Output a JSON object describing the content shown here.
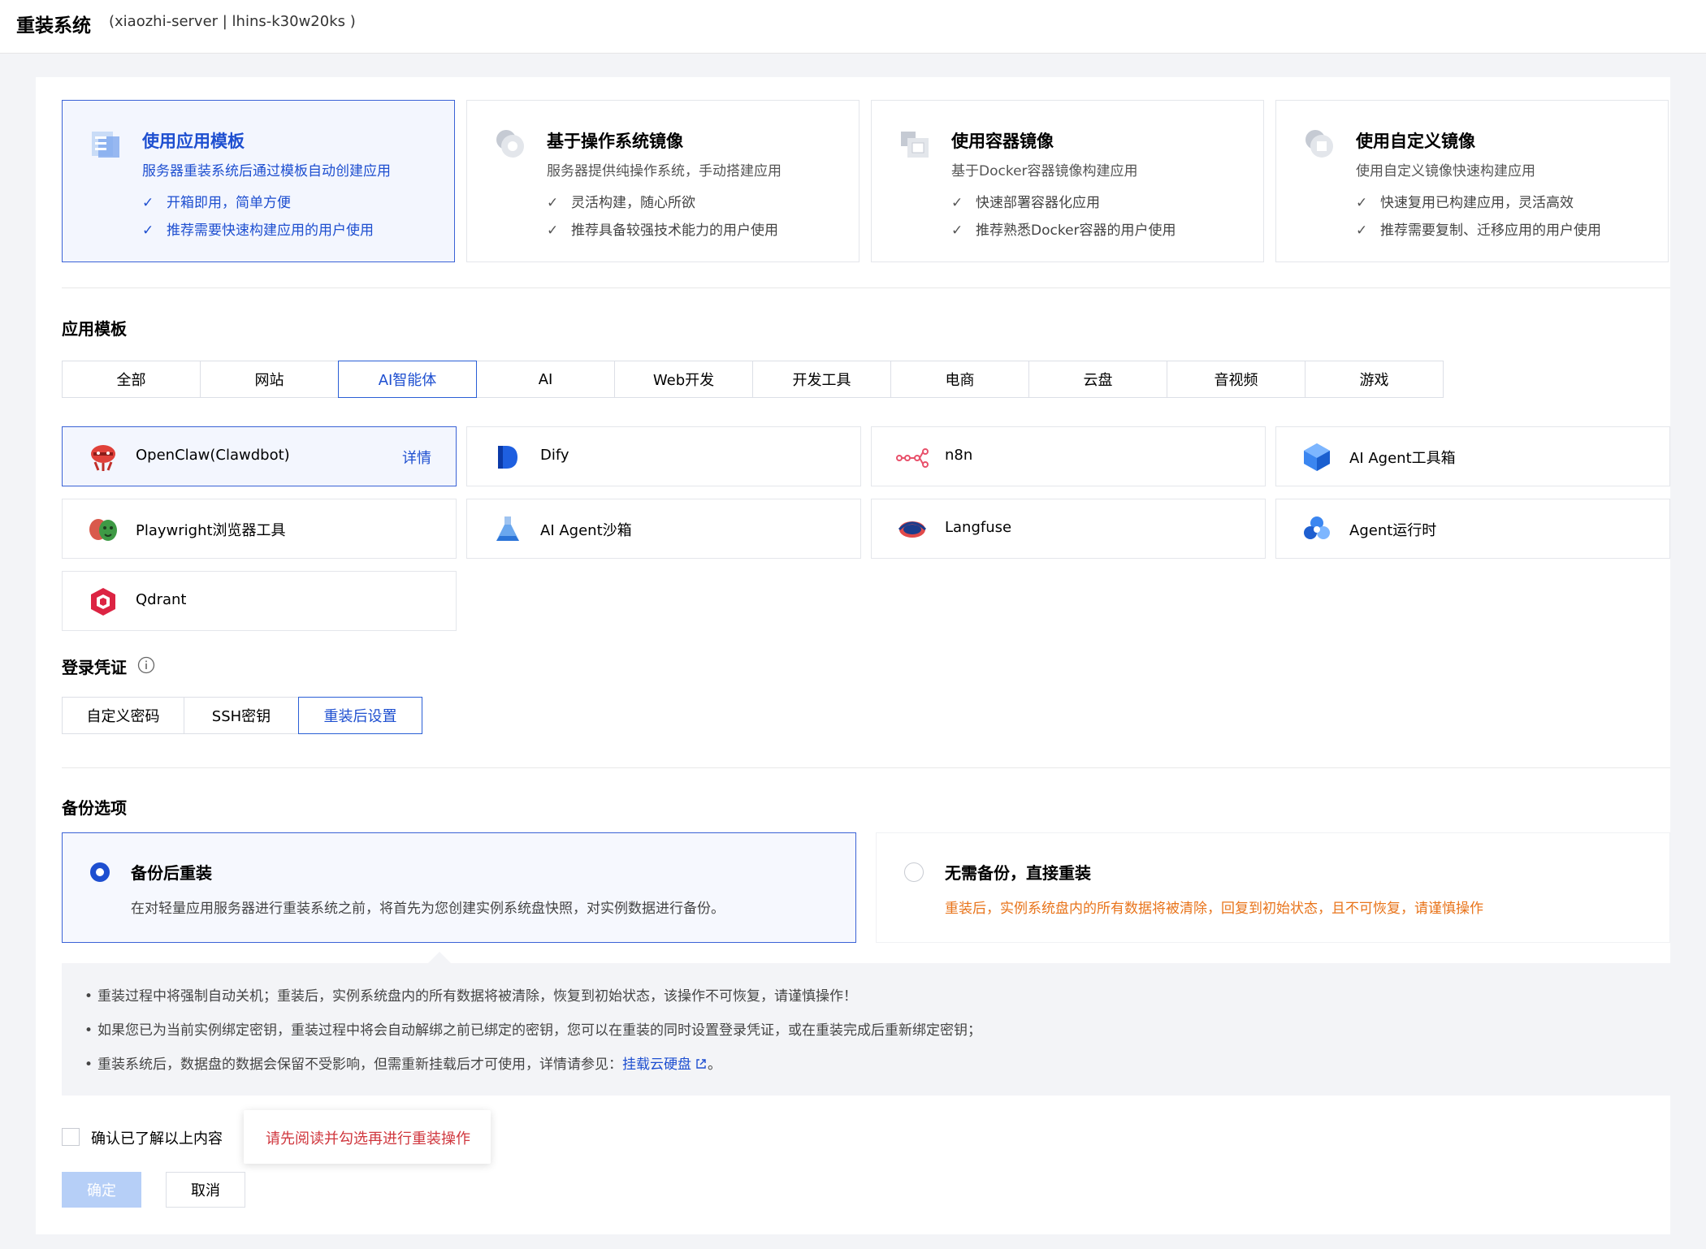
{
  "header": {
    "title": "重装系统",
    "subtitle": "(xiaozhi-server | lhins-k30w20ks )"
  },
  "source_options": [
    {
      "title": "使用应用模板",
      "desc": "服务器重装系统后通过模板自动创建应用",
      "features": [
        "开箱即用，简单方便",
        "推荐需要快速构建应用的用户使用"
      ],
      "icon": "template-icon"
    },
    {
      "title": "基于操作系统镜像",
      "desc": "服务器提供纯操作系统，手动搭建应用",
      "features": [
        "灵活构建，随心所欲",
        "推荐具备较强技术能力的用户使用"
      ],
      "icon": "os-image-icon"
    },
    {
      "title": "使用容器镜像",
      "desc": "基于Docker容器镜像构建应用",
      "features": [
        "快速部署容器化应用",
        "推荐熟悉Docker容器的用户使用"
      ],
      "icon": "container-image-icon"
    },
    {
      "title": "使用自定义镜像",
      "desc": "使用自定义镜像快速构建应用",
      "features": [
        "快速复用已构建应用，灵活高效",
        "推荐需要复制、迁移应用的用户使用"
      ],
      "icon": "custom-image-icon"
    }
  ],
  "app_template": {
    "title": "应用模板",
    "tabs": [
      "全部",
      "网站",
      "AI智能体",
      "AI",
      "Web开发",
      "开发工具",
      "电商",
      "云盘",
      "音视频",
      "游戏"
    ],
    "apps": [
      {
        "name": "OpenClaw(Clawdbot)",
        "icon": "openclaw-icon",
        "detail": "详情"
      },
      {
        "name": "Dify",
        "icon": "dify-icon"
      },
      {
        "name": "n8n",
        "icon": "n8n-icon"
      },
      {
        "name": "AI Agent工具箱",
        "icon": "ai-agent-toolbox-icon"
      },
      {
        "name": "Playwright浏览器工具",
        "icon": "playwright-icon"
      },
      {
        "name": "AI Agent沙箱",
        "icon": "ai-agent-sandbox-icon"
      },
      {
        "name": "Langfuse",
        "icon": "langfuse-icon"
      },
      {
        "name": "Agent运行时",
        "icon": "agent-runtime-icon"
      },
      {
        "name": "Qdrant",
        "icon": "qdrant-icon"
      }
    ]
  },
  "credentials": {
    "title": "登录凭证",
    "tabs": [
      "自定义密码",
      "SSH密钥",
      "重装后设置"
    ]
  },
  "backup": {
    "title": "备份选项",
    "options": [
      {
        "title": "备份后重装",
        "desc": "在对轻量应用服务器进行重装系统之前，将首先为您创建实例系统盘快照，对实例数据进行备份。"
      },
      {
        "title": "无需备份，直接重装",
        "desc": "重装后，实例系统盘内的所有数据将被清除，回复到初始状态，且不可恢复，请谨慎操作"
      }
    ]
  },
  "notice": {
    "line1": "重装过程中将强制自动关机；重装后，实例系统盘内的所有数据将被清除，恢复到初始状态，该操作不可恢复，请谨慎操作！",
    "line2": "如果您已为当前实例绑定密钥，重装过程中将会自动解绑之前已绑定的密钥，您可以在重装的同时设置登录凭证，或在重装完成后重新绑定密钥；",
    "line3_prefix": "重装系统后，数据盘的数据会保留不受影响，但需重新挂载后才可使用，详情请参见：",
    "line3_link": "挂载云硬盘",
    "line3_suffix": "。"
  },
  "confirm": {
    "label": "确认已了解以上内容",
    "tooltip": "请先阅读并勾选再进行重装操作",
    "ok": "确定",
    "cancel": "取消"
  }
}
